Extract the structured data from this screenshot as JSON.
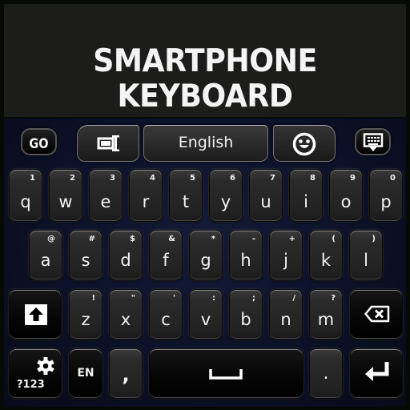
{
  "banner": {
    "title": "SMARTPHONE KEYBOARD"
  },
  "toolbar": {
    "go_label": "GO",
    "cursor_icon": "text-cursor-icon",
    "language_label": "English",
    "emoji_icon": "smiley-face-icon",
    "hide_icon": "keyboard-hide-icon"
  },
  "rows": [
    [
      {
        "main": "q",
        "sub": "1"
      },
      {
        "main": "w",
        "sub": "2"
      },
      {
        "main": "e",
        "sub": "3"
      },
      {
        "main": "r",
        "sub": "4"
      },
      {
        "main": "t",
        "sub": "5"
      },
      {
        "main": "y",
        "sub": "6"
      },
      {
        "main": "u",
        "sub": "7"
      },
      {
        "main": "i",
        "sub": "8"
      },
      {
        "main": "o",
        "sub": "9"
      },
      {
        "main": "p",
        "sub": "0"
      }
    ],
    [
      {
        "main": "a",
        "sub": "@"
      },
      {
        "main": "s",
        "sub": "#"
      },
      {
        "main": "d",
        "sub": "$"
      },
      {
        "main": "f",
        "sub": "&"
      },
      {
        "main": "g",
        "sub": "*"
      },
      {
        "main": "h",
        "sub": "-"
      },
      {
        "main": "j",
        "sub": "+"
      },
      {
        "main": "k",
        "sub": "("
      },
      {
        "main": "l",
        "sub": ")"
      }
    ],
    [
      {
        "main": "z",
        "sub": "!"
      },
      {
        "main": "x",
        "sub": "\""
      },
      {
        "main": "c",
        "sub": "'"
      },
      {
        "main": "v",
        "sub": ":"
      },
      {
        "main": "b",
        "sub": ";"
      },
      {
        "main": "n",
        "sub": "/"
      },
      {
        "main": "m",
        "sub": "?"
      }
    ]
  ],
  "bottom": {
    "symbols_label": "?123",
    "language_short": "EN",
    "comma": ",",
    "period": "."
  },
  "icons": {
    "shift": "shift-arrow-icon",
    "backspace": "backspace-icon",
    "settings": "gear-icon",
    "space": "space-bar-icon",
    "enter": "enter-return-icon"
  }
}
